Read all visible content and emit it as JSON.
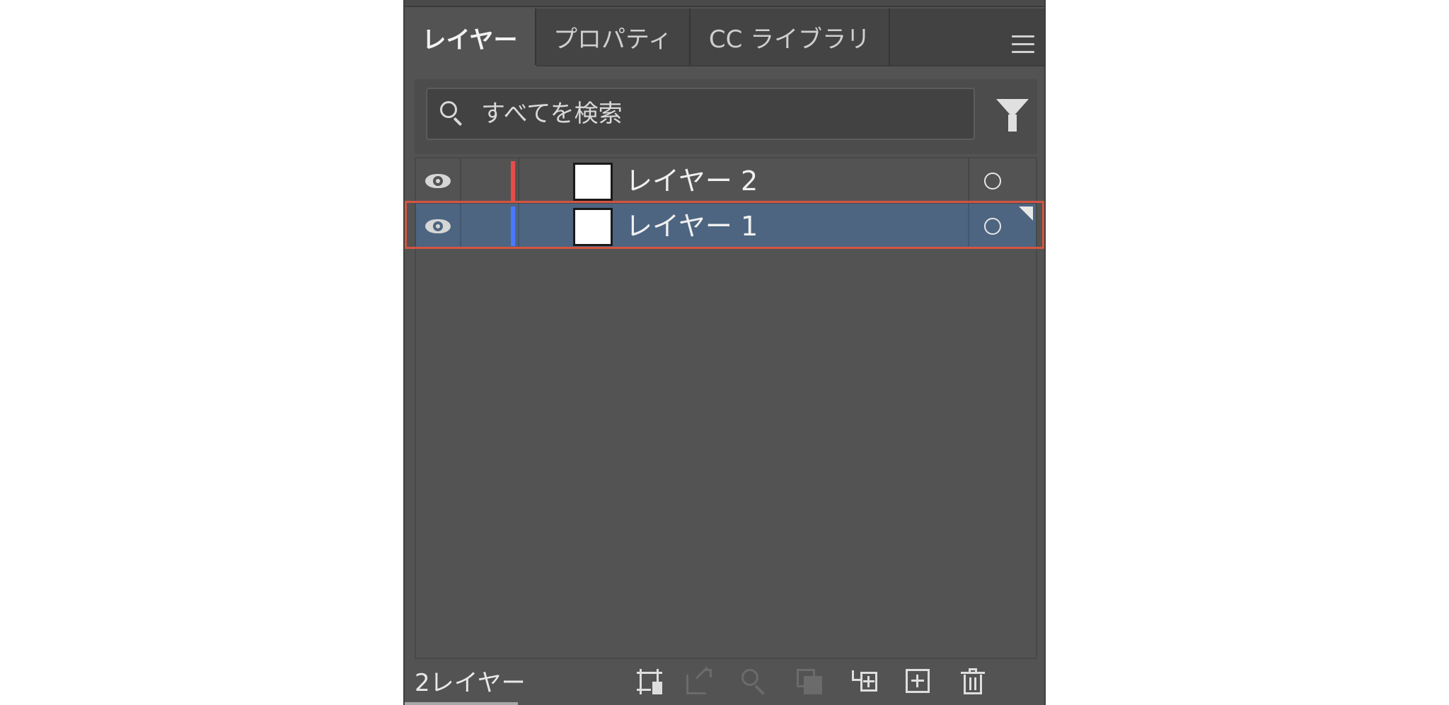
{
  "tabs": [
    {
      "label": "レイヤー",
      "active": true
    },
    {
      "label": "プロパティ",
      "active": false
    },
    {
      "label": "CC ライブラリ",
      "active": false
    }
  ],
  "search": {
    "placeholder": "すべてを検索",
    "value": ""
  },
  "layers": [
    {
      "name": "レイヤー 2",
      "color": "#e94b4b",
      "selected": false,
      "visible": true
    },
    {
      "name": "レイヤー 1",
      "color": "#4a78ff",
      "selected": true,
      "visible": true
    }
  ],
  "footer": {
    "count_label": "2レイヤー"
  },
  "icons": {
    "menu": "hamburger-menu-icon",
    "search": "magnifier-icon",
    "filter": "funnel-icon",
    "visibility": "eye-icon",
    "target": "circle-target-icon",
    "tools": [
      "artboard-collect-icon",
      "export-icon",
      "locate-object-icon",
      "clipping-mask-icon",
      "new-sublayer-icon",
      "new-layer-icon",
      "trash-icon"
    ]
  },
  "colors": {
    "selection_row": "#4d6580",
    "panel_bg": "#535353",
    "highlight_outline": "#d45542"
  }
}
